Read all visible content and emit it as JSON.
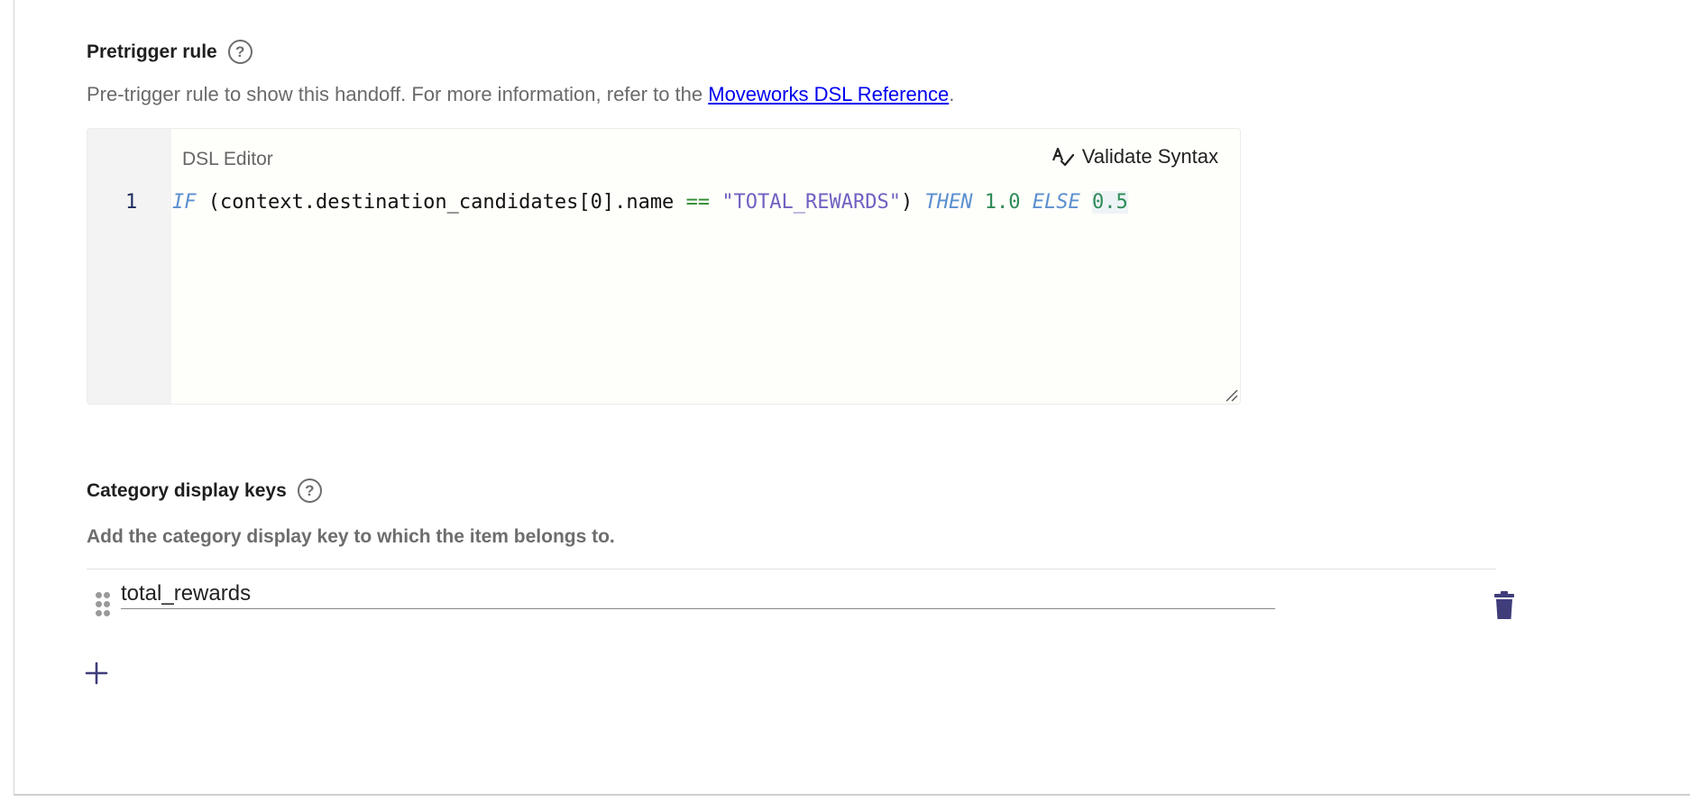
{
  "pretrigger": {
    "title": "Pretrigger rule",
    "help_glyph": "?",
    "description_prefix": "Pre-trigger rule to show this handoff. For more information, refer to the ",
    "link_text": "Moveworks DSL Reference",
    "description_suffix": "."
  },
  "editor": {
    "label": "DSL Editor",
    "validate_label": "Validate Syntax",
    "line_number": "1",
    "code": {
      "kw_if": "IF",
      "expr": " (context.destination_candidates[0].name ",
      "op": "==",
      "str": "\"TOTAL_REWARDS\"",
      "close": ") ",
      "kw_then": "THEN",
      "val_then": "1.0",
      "kw_else": "ELSE",
      "val_else": "0.5"
    }
  },
  "category": {
    "title": "Category display keys",
    "help_glyph": "?",
    "description": "Add the category display key to which the item belongs to.",
    "items": [
      {
        "value": "total_rewards"
      }
    ]
  },
  "colors": {
    "accent": "#3f3d7a",
    "link": "#0000ee",
    "keyword": "#5b8fd0",
    "string": "#6f62c2",
    "number": "#2e8b57"
  },
  "icons": {
    "help": "question-circle-icon",
    "validate": "spellcheck-icon",
    "drag": "drag-handle-icon",
    "delete": "trash-icon",
    "add": "plus-icon"
  }
}
